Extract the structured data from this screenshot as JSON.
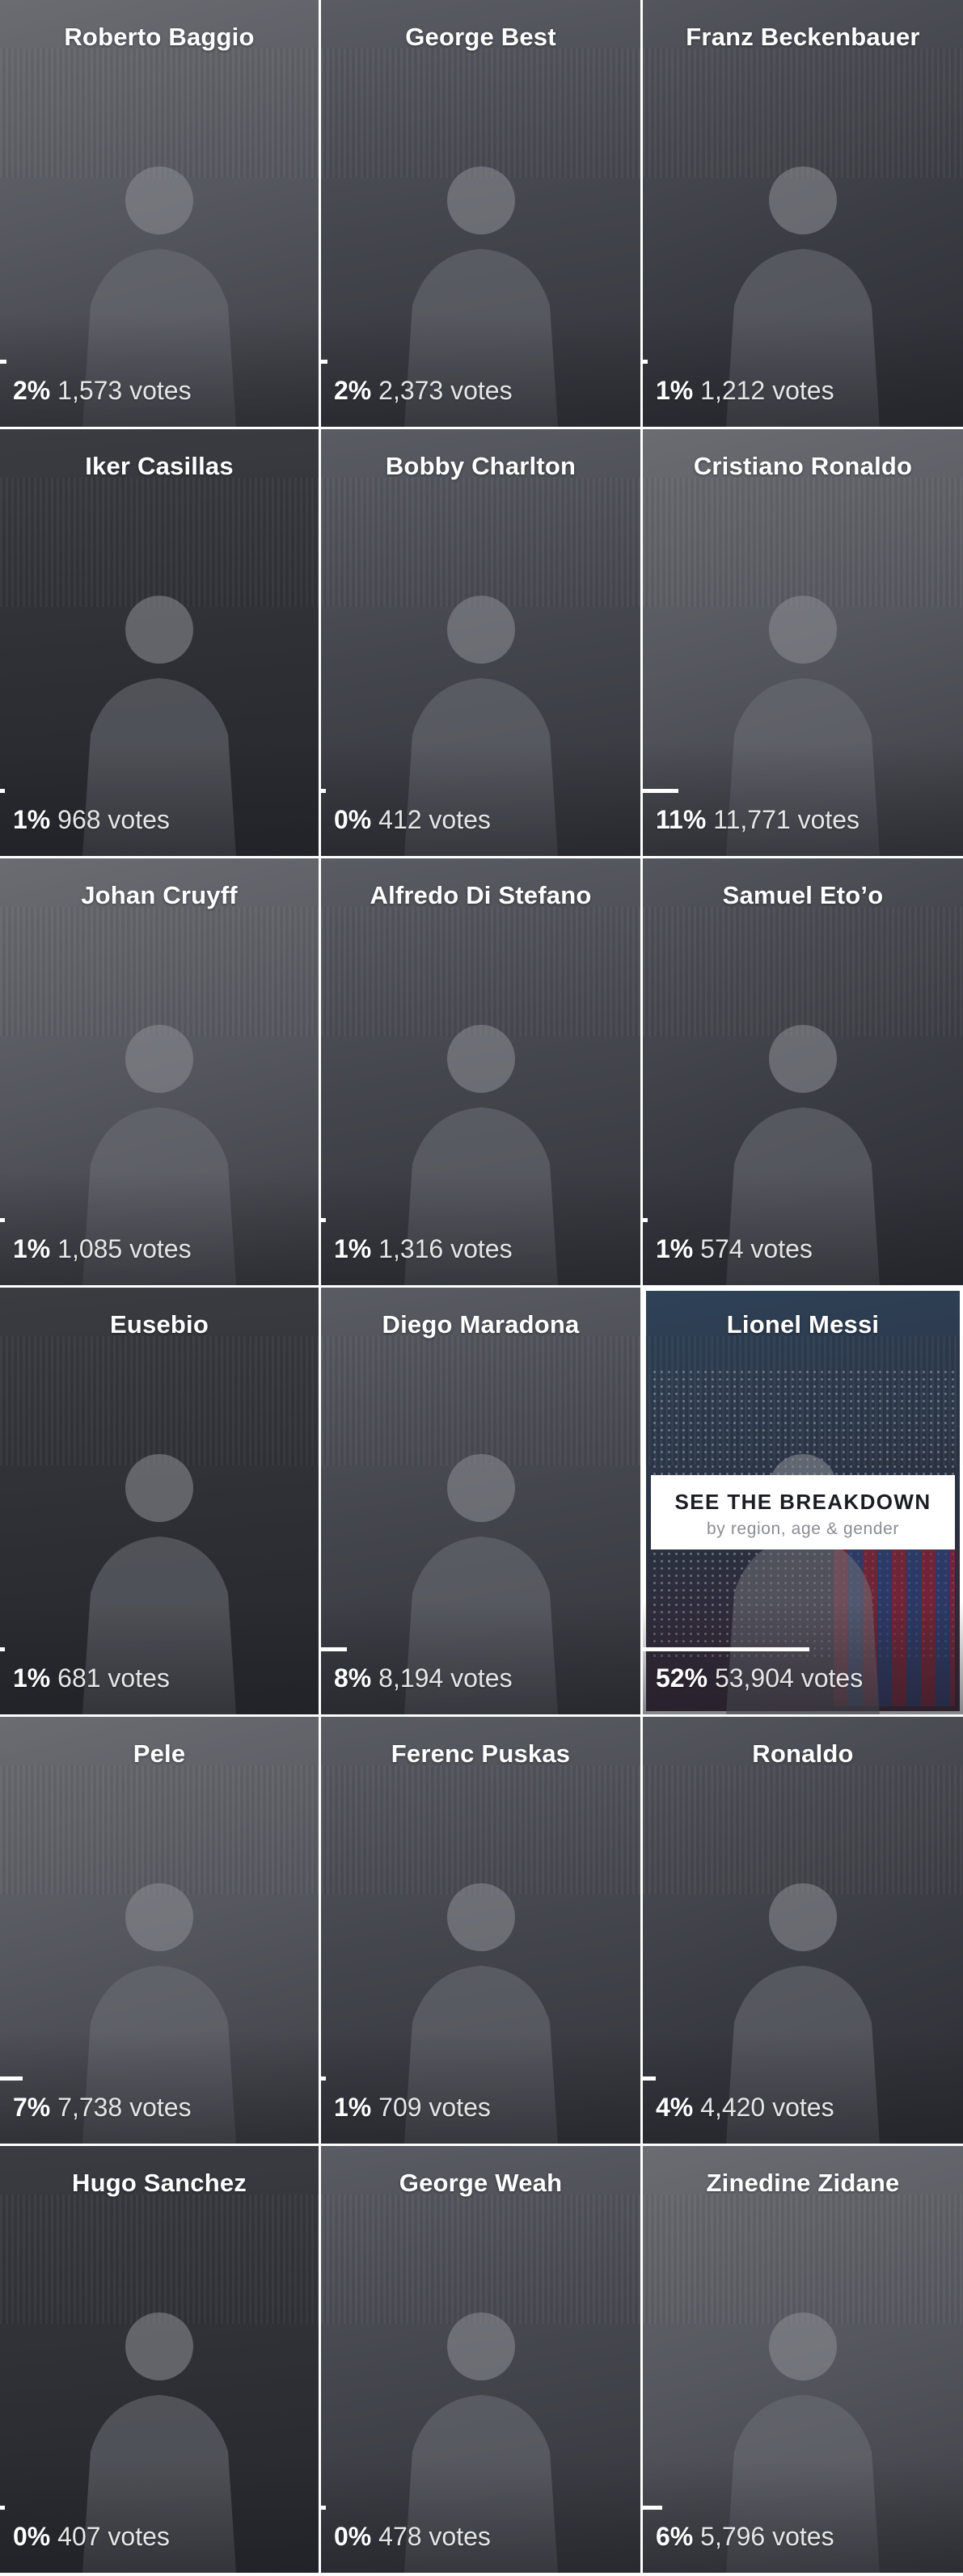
{
  "players": [
    {
      "name": "Roberto Baggio",
      "pct": "2%",
      "votes": "1,573 votes",
      "share": 0.02
    },
    {
      "name": "George Best",
      "pct": "2%",
      "votes": "2,373 votes",
      "share": 0.02
    },
    {
      "name": "Franz Beckenbauer",
      "pct": "1%",
      "votes": "1,212 votes",
      "share": 0.01
    },
    {
      "name": "Iker Casillas",
      "pct": "1%",
      "votes": "968 votes",
      "share": 0.01
    },
    {
      "name": "Bobby Charlton",
      "pct": "0%",
      "votes": "412 votes",
      "share": 0.0
    },
    {
      "name": "Cristiano Ronaldo",
      "pct": "11%",
      "votes": "11,771 votes",
      "share": 0.11
    },
    {
      "name": "Johan Cruyff",
      "pct": "1%",
      "votes": "1,085 votes",
      "share": 0.01
    },
    {
      "name": "Alfredo Di Stefano",
      "pct": "1%",
      "votes": "1,316 votes",
      "share": 0.01
    },
    {
      "name": "Samuel Eto’o",
      "pct": "1%",
      "votes": "574 votes",
      "share": 0.01
    },
    {
      "name": "Eusebio",
      "pct": "1%",
      "votes": "681 votes",
      "share": 0.01
    },
    {
      "name": "Diego Maradona",
      "pct": "8%",
      "votes": "8,194 votes",
      "share": 0.08
    },
    {
      "name": "Lionel Messi",
      "pct": "52%",
      "votes": "53,904 votes",
      "share": 0.52,
      "featured": true
    },
    {
      "name": "Pele",
      "pct": "7%",
      "votes": "7,738 votes",
      "share": 0.07
    },
    {
      "name": "Ferenc Puskas",
      "pct": "1%",
      "votes": "709 votes",
      "share": 0.01
    },
    {
      "name": "Ronaldo",
      "pct": "4%",
      "votes": "4,420 votes",
      "share": 0.04
    },
    {
      "name": "Hugo Sanchez",
      "pct": "0%",
      "votes": "407 votes",
      "share": 0.0
    },
    {
      "name": "George Weah",
      "pct": "0%",
      "votes": "478 votes",
      "share": 0.0
    },
    {
      "name": "Zinedine Zidane",
      "pct": "6%",
      "votes": "5,796 votes",
      "share": 0.06
    }
  ],
  "breakdown": {
    "title": "SEE THE BREAKDOWN",
    "subtitle": "by region, age & gender"
  },
  "colors": {
    "bar": "#ffffff",
    "overlay": "#3a3c42",
    "featured_border": "#ffffff"
  }
}
